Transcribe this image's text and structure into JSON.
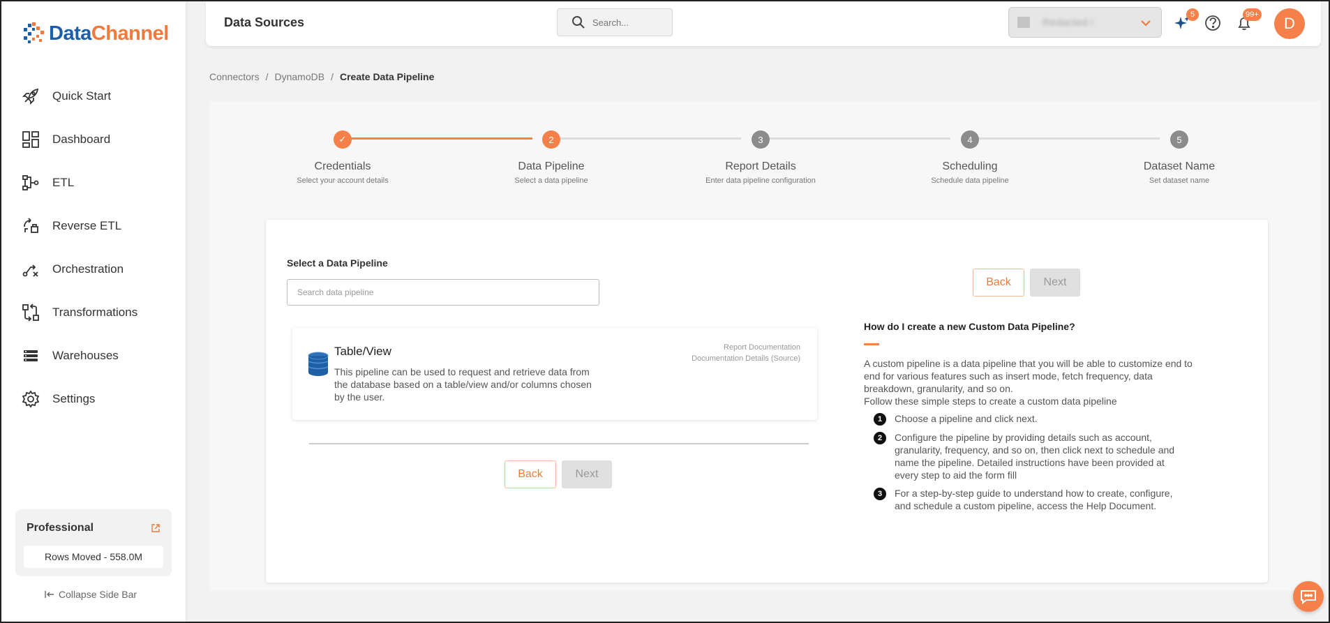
{
  "logo": {
    "part1": "Data",
    "part2": "Channel"
  },
  "sidebar": {
    "items": [
      {
        "label": "Quick Start",
        "icon": "rocket-icon"
      },
      {
        "label": "Dashboard",
        "icon": "dashboard-icon"
      },
      {
        "label": "ETL",
        "icon": "etl-icon"
      },
      {
        "label": "Reverse ETL",
        "icon": "reverse-etl-icon"
      },
      {
        "label": "Orchestration",
        "icon": "orchestration-icon"
      },
      {
        "label": "Transformations",
        "icon": "transformations-icon"
      },
      {
        "label": "Warehouses",
        "icon": "warehouses-icon"
      },
      {
        "label": "Settings",
        "icon": "gear-icon"
      }
    ],
    "plan": {
      "name": "Professional",
      "rows_moved": "Rows Moved - 558.0M"
    },
    "collapse_label": "Collapse Side Bar"
  },
  "header": {
    "title": "Data Sources",
    "search_placeholder": "Search...",
    "account_name": "Redacted I",
    "ai_badge": "5",
    "notif_badge": "99+",
    "avatar_initial": "D"
  },
  "breadcrumb": {
    "items": [
      "Connectors",
      "DynamoDB",
      "Create Data Pipeline"
    ],
    "sep": "/"
  },
  "stepper": {
    "steps": [
      {
        "num": "✓",
        "title": "Credentials",
        "sub": "Select your account details",
        "state": "done"
      },
      {
        "num": "2",
        "title": "Data Pipeline",
        "sub": "Select a data pipeline",
        "state": "active"
      },
      {
        "num": "3",
        "title": "Report Details",
        "sub": "Enter data pipeline configuration",
        "state": "pending"
      },
      {
        "num": "4",
        "title": "Scheduling",
        "sub": "Schedule data pipeline",
        "state": "pending"
      },
      {
        "num": "5",
        "title": "Dataset Name",
        "sub": "Set dataset name",
        "state": "pending"
      }
    ]
  },
  "main": {
    "select_label": "Select a Data Pipeline",
    "search_placeholder": "Search data pipeline",
    "pipeline": {
      "title": "Table/View",
      "description": "This pipeline can be used to request and retrieve data from the database based on a table/view and/or columns chosen by the user.",
      "doc_link_1": "Report Documentation",
      "doc_link_2": "Documentation Details (Source)"
    },
    "back_label": "Back",
    "next_label": "Next"
  },
  "help": {
    "title": "How do I create a new Custom Data Pipeline?",
    "intro": "A custom pipeline is a data pipeline that you will be able to customize end to end for various features such as insert mode, fetch frequency, data breakdown, granularity, and so on.",
    "intro2": "Follow these simple steps to create a custom data pipeline",
    "steps": [
      "Choose a pipeline and click next.",
      "Configure the pipeline by providing details such as account, granularity, frequency, and so on, then click next to schedule and name the pipeline. Detailed instructions have been provided at every step to aid the form fill",
      "For a step-by-step guide to understand how to create, configure, and schedule a custom pipeline, access the Help Document."
    ]
  },
  "colors": {
    "accent": "#f5804a",
    "brand_blue": "#1b5faa",
    "step_pending": "#8c8c8c",
    "line_pending": "#dddddd"
  }
}
